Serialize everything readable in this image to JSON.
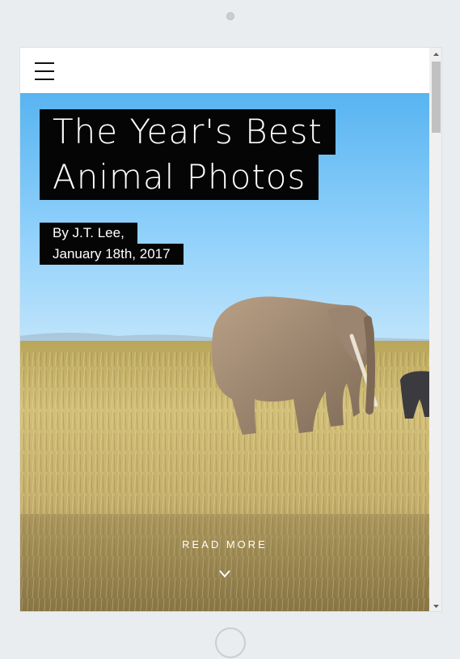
{
  "article": {
    "title_line1": "The Year's Best",
    "title_line2": "Animal Photos",
    "byline_line1": "By J.T. Lee,",
    "byline_line2": "January 18th, 2017",
    "read_more": "READ MORE",
    "chevron_glyph": "v"
  },
  "icons": {
    "menu": "hamburger-icon",
    "scroll_up": "arrow-up-icon",
    "scroll_down": "arrow-down-icon",
    "read_more_chevron": "chevron-down-icon"
  },
  "colors": {
    "device_bg": "#e9edf0",
    "title_bg": "#050505",
    "title_text": "#ffffff",
    "sky_top": "#5cb8f2",
    "grass": "#c8b26a"
  }
}
